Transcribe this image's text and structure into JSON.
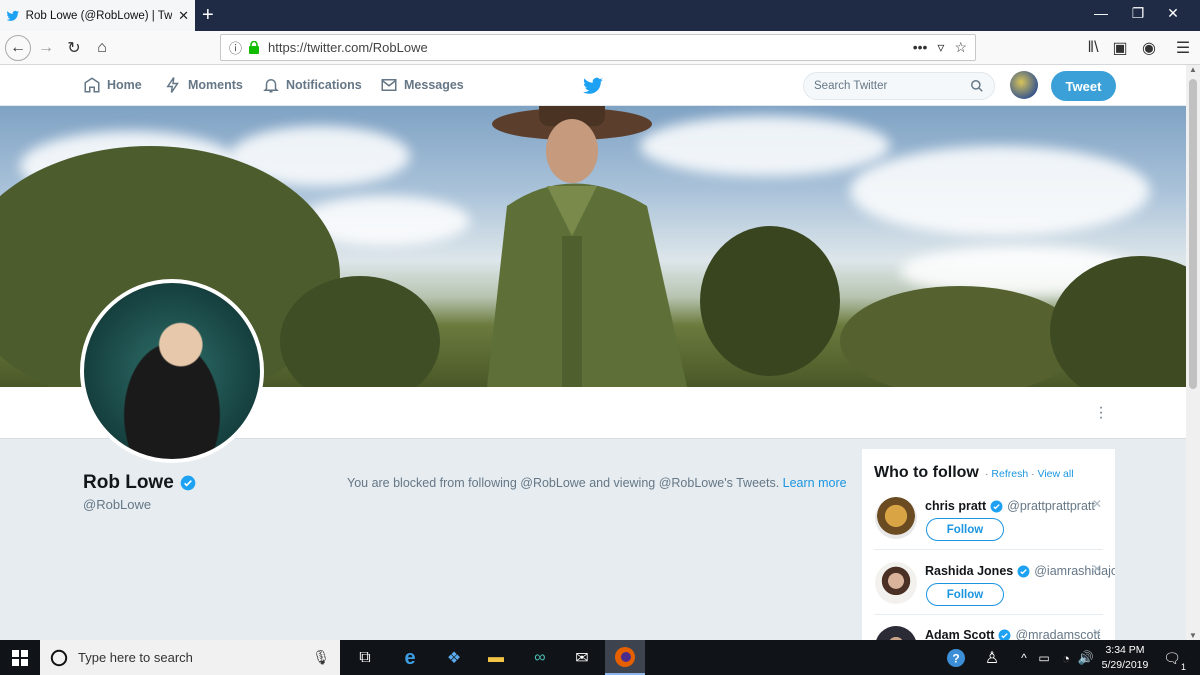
{
  "browser": {
    "tab_title": "Rob Lowe (@RobLowe) | Twitter",
    "url": "https://twitter.com/RobLowe"
  },
  "twitter_nav": {
    "home": "Home",
    "moments": "Moments",
    "notifications": "Notifications",
    "messages": "Messages",
    "search_placeholder": "Search Twitter",
    "tweet_button": "Tweet"
  },
  "profile": {
    "name": "Rob Lowe",
    "handle": "@RobLowe",
    "blocked_message": "You are blocked from following @RobLowe and viewing @RobLowe's Tweets.",
    "learn_more": "Learn more"
  },
  "who_to_follow": {
    "title": "Who to follow",
    "refresh": "Refresh",
    "view_all": "View all",
    "separator": "·",
    "follow_label": "Follow",
    "items": [
      {
        "name": "chris pratt",
        "handle": "@prattprattpratt"
      },
      {
        "name": "Rashida Jones",
        "handle": "@iamrashidajones"
      },
      {
        "name": "Adam Scott",
        "handle": "@mradamscott"
      }
    ]
  },
  "taskbar": {
    "search_placeholder": "Type here to search",
    "time": "3:34 PM",
    "date": "5/29/2019",
    "notification_count": "1"
  },
  "colors": {
    "twitter_blue": "#1b95e0",
    "tweet_button": "#3ba0d7",
    "page_background": "#e6ecf0"
  }
}
